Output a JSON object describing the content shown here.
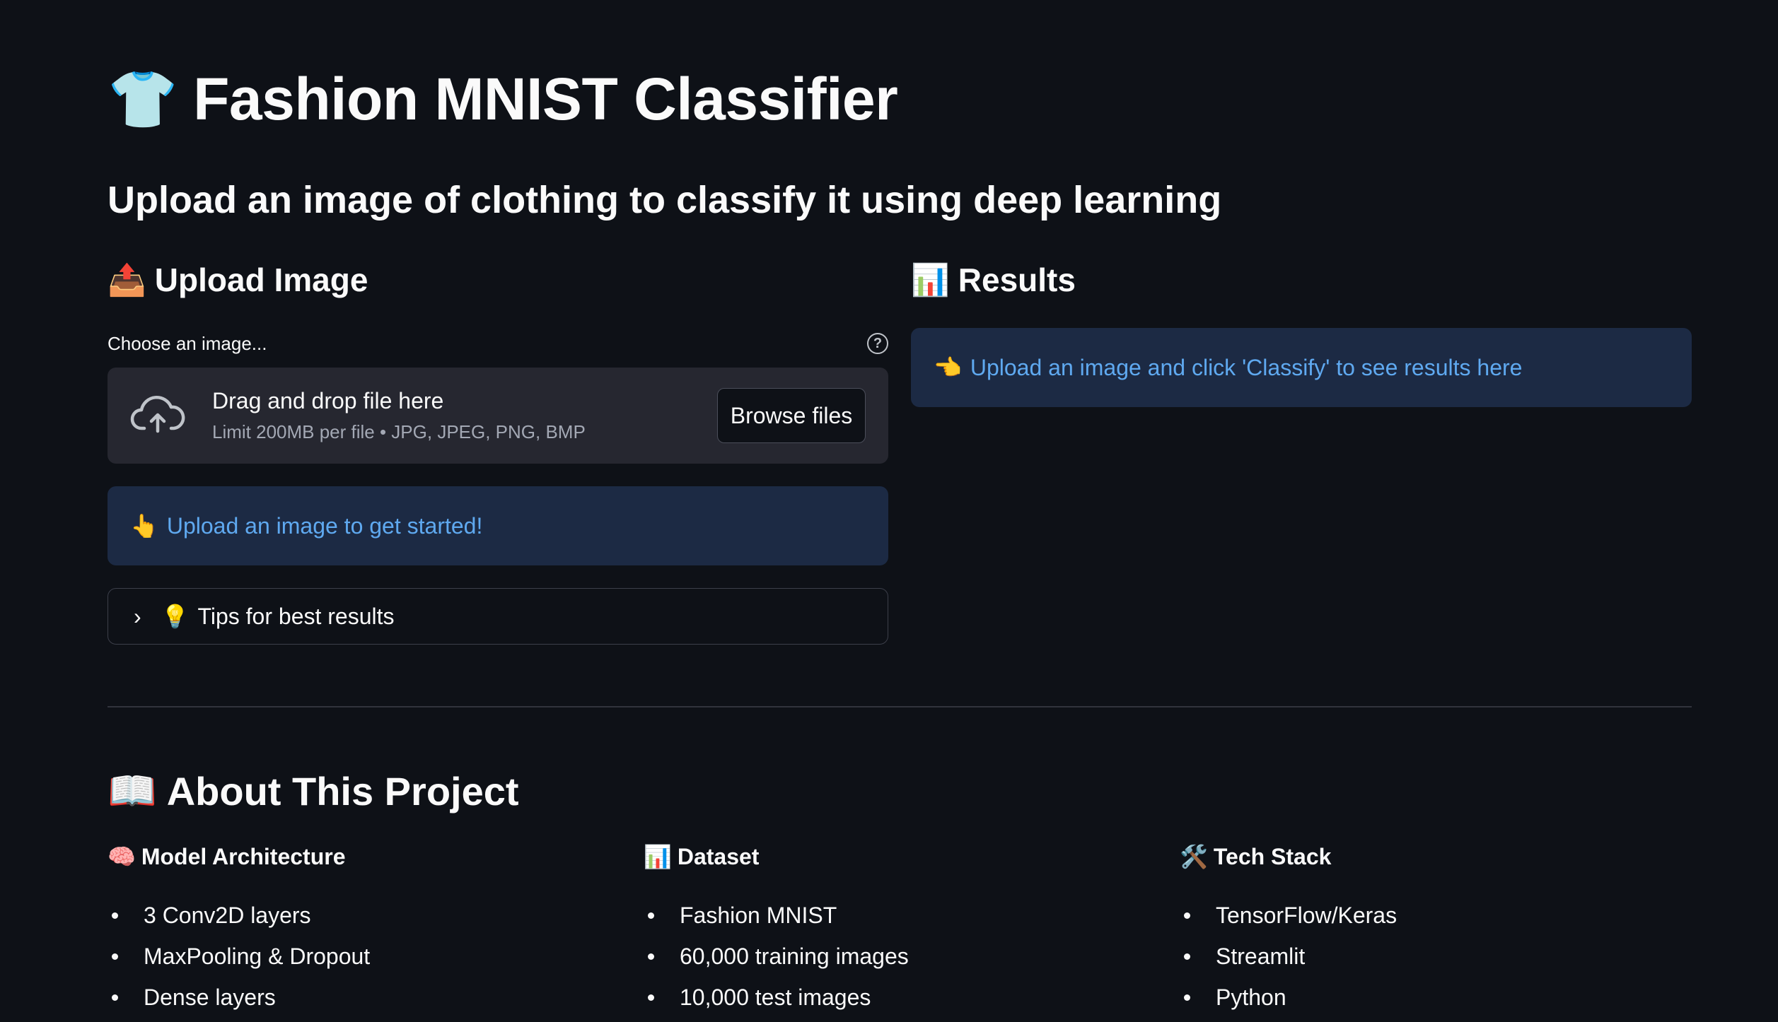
{
  "header": {
    "title": "Fashion MNIST Classifier",
    "title_icon": "👕",
    "subtitle": "Upload an image of clothing to classify it using deep learning"
  },
  "upload": {
    "heading": "Upload Image",
    "heading_icon": "📤",
    "label": "Choose an image...",
    "drop_text": "Drag and drop file here",
    "limit_text": "Limit 200MB per file • JPG, JPEG, PNG, BMP",
    "browse_label": "Browse files",
    "info_icon": "👆",
    "info_text": "Upload an image to get started!",
    "tips_icon": "💡",
    "tips_label": "Tips for best results"
  },
  "results": {
    "heading": "Results",
    "heading_icon": "📊",
    "info_icon": "👈",
    "info_text": "Upload an image and click 'Classify' to see results here"
  },
  "about": {
    "heading": "About This Project",
    "heading_icon": "📖",
    "columns": [
      {
        "icon": "🧠",
        "title": "Model Architecture",
        "items": [
          "3 Conv2D layers",
          "MaxPooling & Dropout",
          "Dense layers"
        ]
      },
      {
        "icon": "📊",
        "title": "Dataset",
        "items": [
          "Fashion MNIST",
          "60,000 training images",
          "10,000 test images"
        ]
      },
      {
        "icon": "🛠️",
        "title": "Tech Stack",
        "items": [
          "TensorFlow/Keras",
          "Streamlit",
          "Python"
        ]
      }
    ]
  },
  "colors": {
    "background": "#0e1117",
    "info_bg": "#1c2a44",
    "info_text": "#5fa9f0",
    "dropzone_bg": "#262730"
  }
}
